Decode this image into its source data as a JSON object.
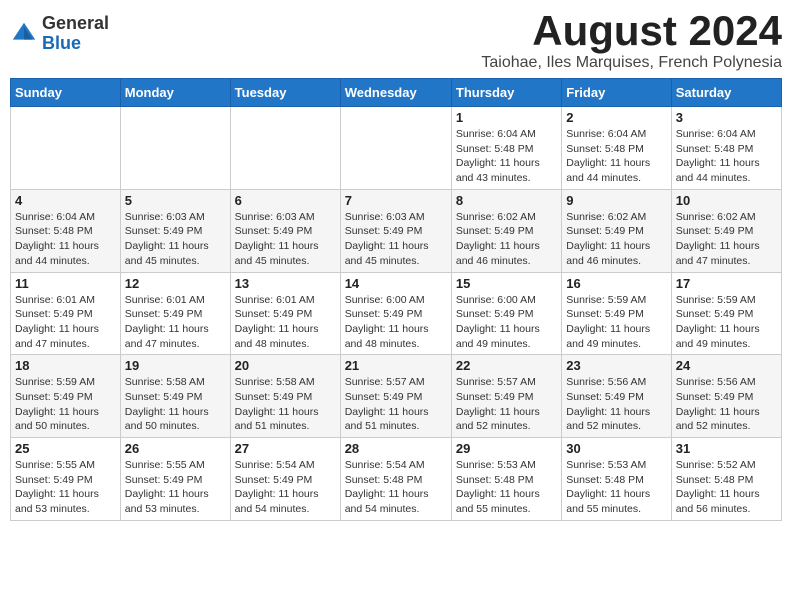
{
  "logo": {
    "general": "General",
    "blue": "Blue"
  },
  "title": "August 2024",
  "subtitle": "Taiohae, Iles Marquises, French Polynesia",
  "headers": [
    "Sunday",
    "Monday",
    "Tuesday",
    "Wednesday",
    "Thursday",
    "Friday",
    "Saturday"
  ],
  "weeks": [
    [
      {
        "day": "",
        "info": ""
      },
      {
        "day": "",
        "info": ""
      },
      {
        "day": "",
        "info": ""
      },
      {
        "day": "",
        "info": ""
      },
      {
        "day": "1",
        "info": "Sunrise: 6:04 AM\nSunset: 5:48 PM\nDaylight: 11 hours\nand 43 minutes."
      },
      {
        "day": "2",
        "info": "Sunrise: 6:04 AM\nSunset: 5:48 PM\nDaylight: 11 hours\nand 44 minutes."
      },
      {
        "day": "3",
        "info": "Sunrise: 6:04 AM\nSunset: 5:48 PM\nDaylight: 11 hours\nand 44 minutes."
      }
    ],
    [
      {
        "day": "4",
        "info": "Sunrise: 6:04 AM\nSunset: 5:48 PM\nDaylight: 11 hours\nand 44 minutes."
      },
      {
        "day": "5",
        "info": "Sunrise: 6:03 AM\nSunset: 5:49 PM\nDaylight: 11 hours\nand 45 minutes."
      },
      {
        "day": "6",
        "info": "Sunrise: 6:03 AM\nSunset: 5:49 PM\nDaylight: 11 hours\nand 45 minutes."
      },
      {
        "day": "7",
        "info": "Sunrise: 6:03 AM\nSunset: 5:49 PM\nDaylight: 11 hours\nand 45 minutes."
      },
      {
        "day": "8",
        "info": "Sunrise: 6:02 AM\nSunset: 5:49 PM\nDaylight: 11 hours\nand 46 minutes."
      },
      {
        "day": "9",
        "info": "Sunrise: 6:02 AM\nSunset: 5:49 PM\nDaylight: 11 hours\nand 46 minutes."
      },
      {
        "day": "10",
        "info": "Sunrise: 6:02 AM\nSunset: 5:49 PM\nDaylight: 11 hours\nand 47 minutes."
      }
    ],
    [
      {
        "day": "11",
        "info": "Sunrise: 6:01 AM\nSunset: 5:49 PM\nDaylight: 11 hours\nand 47 minutes."
      },
      {
        "day": "12",
        "info": "Sunrise: 6:01 AM\nSunset: 5:49 PM\nDaylight: 11 hours\nand 47 minutes."
      },
      {
        "day": "13",
        "info": "Sunrise: 6:01 AM\nSunset: 5:49 PM\nDaylight: 11 hours\nand 48 minutes."
      },
      {
        "day": "14",
        "info": "Sunrise: 6:00 AM\nSunset: 5:49 PM\nDaylight: 11 hours\nand 48 minutes."
      },
      {
        "day": "15",
        "info": "Sunrise: 6:00 AM\nSunset: 5:49 PM\nDaylight: 11 hours\nand 49 minutes."
      },
      {
        "day": "16",
        "info": "Sunrise: 5:59 AM\nSunset: 5:49 PM\nDaylight: 11 hours\nand 49 minutes."
      },
      {
        "day": "17",
        "info": "Sunrise: 5:59 AM\nSunset: 5:49 PM\nDaylight: 11 hours\nand 49 minutes."
      }
    ],
    [
      {
        "day": "18",
        "info": "Sunrise: 5:59 AM\nSunset: 5:49 PM\nDaylight: 11 hours\nand 50 minutes."
      },
      {
        "day": "19",
        "info": "Sunrise: 5:58 AM\nSunset: 5:49 PM\nDaylight: 11 hours\nand 50 minutes."
      },
      {
        "day": "20",
        "info": "Sunrise: 5:58 AM\nSunset: 5:49 PM\nDaylight: 11 hours\nand 51 minutes."
      },
      {
        "day": "21",
        "info": "Sunrise: 5:57 AM\nSunset: 5:49 PM\nDaylight: 11 hours\nand 51 minutes."
      },
      {
        "day": "22",
        "info": "Sunrise: 5:57 AM\nSunset: 5:49 PM\nDaylight: 11 hours\nand 52 minutes."
      },
      {
        "day": "23",
        "info": "Sunrise: 5:56 AM\nSunset: 5:49 PM\nDaylight: 11 hours\nand 52 minutes."
      },
      {
        "day": "24",
        "info": "Sunrise: 5:56 AM\nSunset: 5:49 PM\nDaylight: 11 hours\nand 52 minutes."
      }
    ],
    [
      {
        "day": "25",
        "info": "Sunrise: 5:55 AM\nSunset: 5:49 PM\nDaylight: 11 hours\nand 53 minutes."
      },
      {
        "day": "26",
        "info": "Sunrise: 5:55 AM\nSunset: 5:49 PM\nDaylight: 11 hours\nand 53 minutes."
      },
      {
        "day": "27",
        "info": "Sunrise: 5:54 AM\nSunset: 5:49 PM\nDaylight: 11 hours\nand 54 minutes."
      },
      {
        "day": "28",
        "info": "Sunrise: 5:54 AM\nSunset: 5:48 PM\nDaylight: 11 hours\nand 54 minutes."
      },
      {
        "day": "29",
        "info": "Sunrise: 5:53 AM\nSunset: 5:48 PM\nDaylight: 11 hours\nand 55 minutes."
      },
      {
        "day": "30",
        "info": "Sunrise: 5:53 AM\nSunset: 5:48 PM\nDaylight: 11 hours\nand 55 minutes."
      },
      {
        "day": "31",
        "info": "Sunrise: 5:52 AM\nSunset: 5:48 PM\nDaylight: 11 hours\nand 56 minutes."
      }
    ]
  ]
}
